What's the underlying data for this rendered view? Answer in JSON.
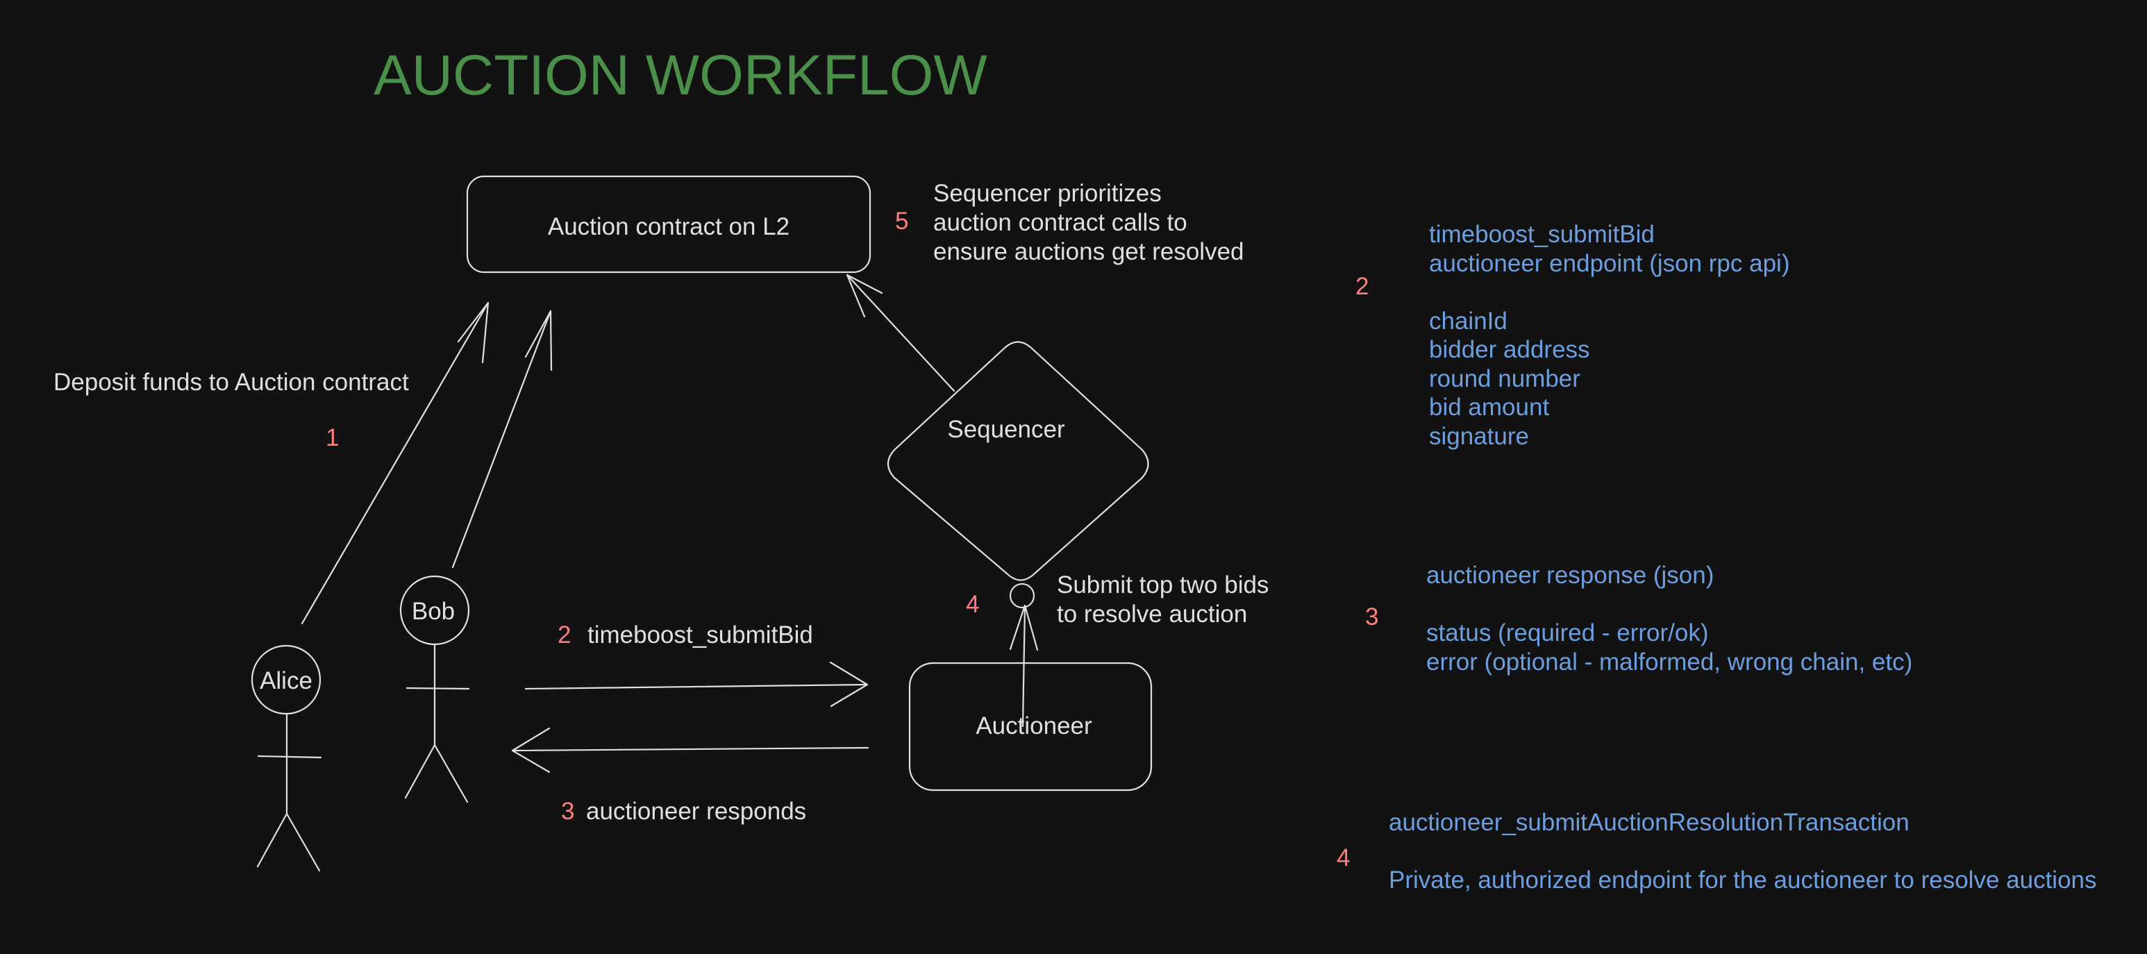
{
  "title": "AUCTION WORKFLOW",
  "colors": {
    "background": "#121212",
    "title": "#4a8f4a",
    "step_number": "#ff7f7f",
    "annotation": "#6c9fe0",
    "stroke": "#e0e0e0"
  },
  "nodes": {
    "auction_contract": "Auction contract on L2",
    "sequencer": "Sequencer",
    "auctioneer": "Auctioneer",
    "alice": "Alice",
    "bob": "Bob"
  },
  "edges": {
    "deposit": {
      "label": "Deposit funds to Auction contract",
      "step": "1"
    },
    "submit_bid": {
      "label": "timeboost_submitBid",
      "step": "2"
    },
    "responds": {
      "label": "auctioneer responds",
      "step": "3"
    },
    "submit_top_bids": {
      "lines": [
        "Submit top two bids",
        "to resolve auction"
      ],
      "step": "4"
    },
    "sequencer_prioritizes": {
      "lines": [
        "Sequencer prioritizes",
        "auction contract calls to",
        "ensure auctions get resolved"
      ],
      "step": "5"
    }
  },
  "notes": [
    {
      "step": "2",
      "lines": [
        "timeboost_submitBid",
        "auctioneer endpoint (json rpc api)",
        "",
        "chainId",
        "bidder address",
        "round number",
        "bid amount",
        "signature"
      ]
    },
    {
      "step": "3",
      "lines": [
        "auctioneer response (json)",
        "",
        "status (required - error/ok)",
        "error (optional - malformed, wrong chain, etc)"
      ]
    },
    {
      "step": "4",
      "lines": [
        "auctioneer_submitAuctionResolutionTransaction",
        "",
        "Private, authorized endpoint for the auctioneer to resolve auctions"
      ]
    }
  ]
}
